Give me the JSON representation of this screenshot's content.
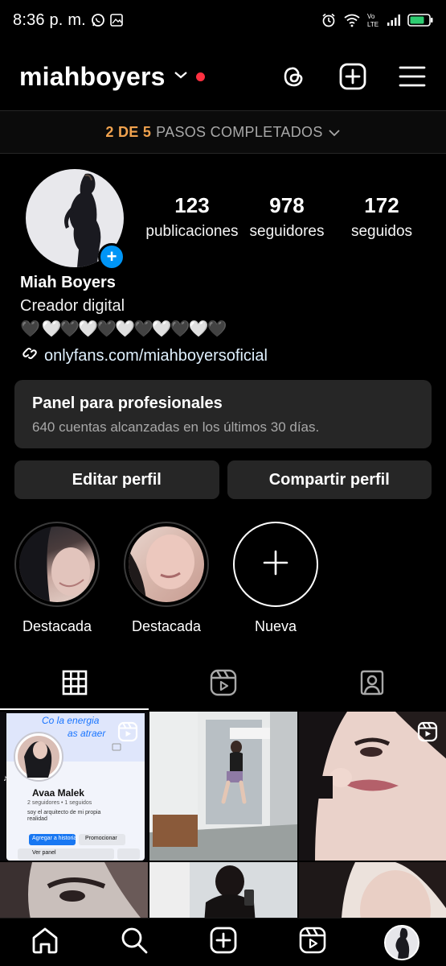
{
  "status_bar": {
    "time": "8:36 p. m."
  },
  "header": {
    "username": "miahboyers"
  },
  "steps": {
    "done": "2 DE 5",
    "rest": "PASOS COMPLETADOS"
  },
  "profile": {
    "stats": [
      {
        "value": "123",
        "label": "publicaciones"
      },
      {
        "value": "978",
        "label": "seguidores"
      },
      {
        "value": "172",
        "label": "seguidos"
      }
    ],
    "name": "Miah Boyers",
    "category": "Creador digital",
    "bio_line": "🖤 🤍🖤🤍🖤🤍🖤🤍🖤🤍🖤",
    "link": "onlyfans.com/miahboyersoficial"
  },
  "pro_panel": {
    "title": "Panel para profesionales",
    "subtitle": "640 cuentas alcanzadas en los últimos 30 días."
  },
  "buttons": {
    "edit": "Editar perfil",
    "share": "Compartir perfil"
  },
  "highlights": [
    {
      "label": "Destacada"
    },
    {
      "label": "Destacada"
    },
    {
      "label": "Nueva"
    }
  ],
  "grid_post_1": {
    "line1": "Co la energia",
    "line2": "as atraer",
    "profile_name": "Avaa Malek",
    "stats": "2 seguidores • 1 seguidos",
    "bio": "soy el arquitecto de mi propia realidad",
    "btn1": "Agregar a historia",
    "btn2": "Promocionar",
    "btn3": "Ver panel"
  },
  "colors": {
    "accent_blue": "#0095f6",
    "steps_orange": "#f0a24e",
    "panel_bg": "#262626",
    "notification_red": "#ff3040"
  }
}
